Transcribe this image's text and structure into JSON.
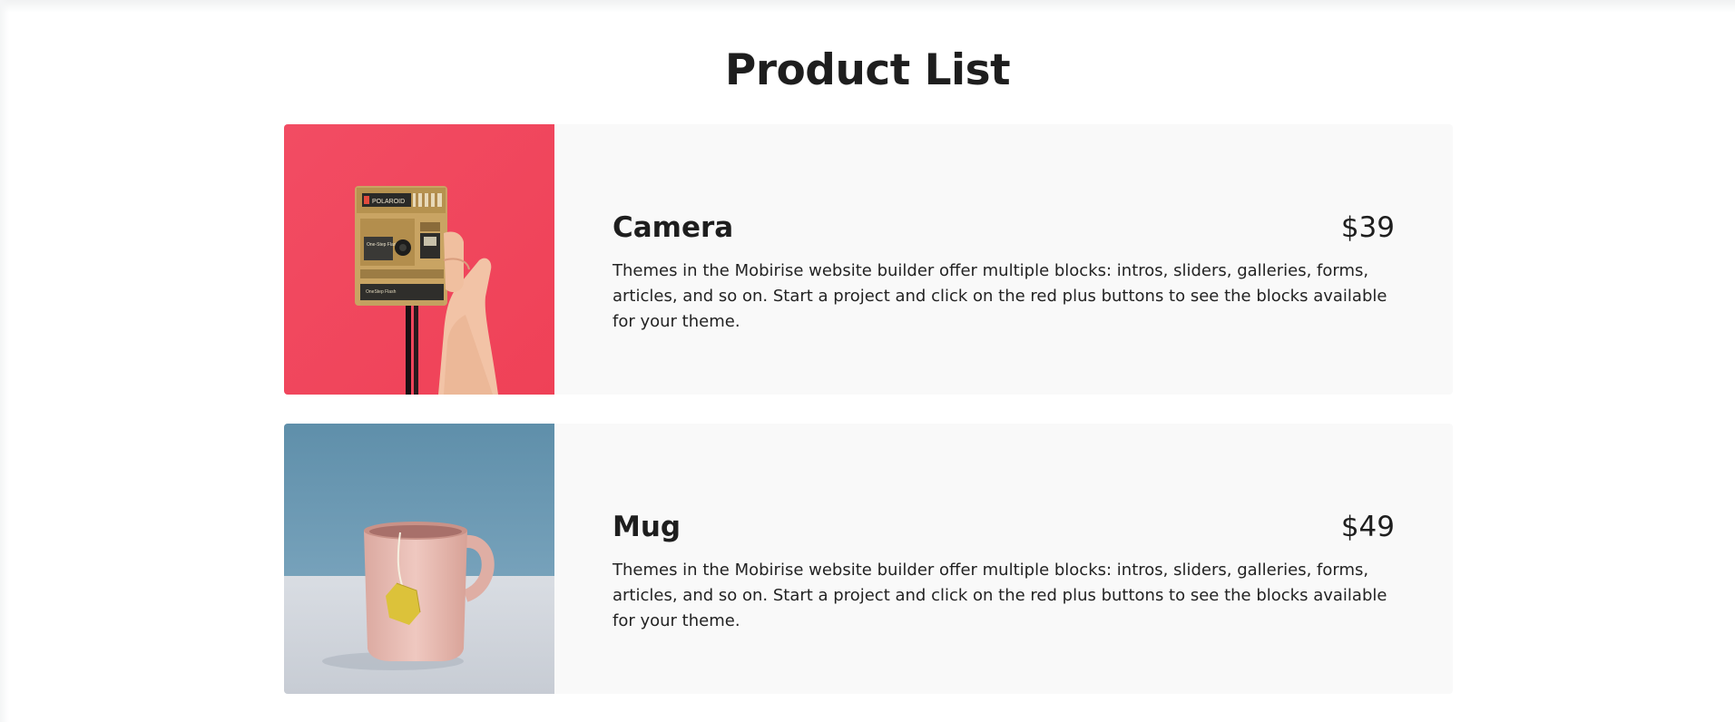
{
  "page": {
    "title": "Product List"
  },
  "products": [
    {
      "name": "Camera",
      "price": "$39",
      "description": "Themes in the Mobirise website builder offer multiple blocks: intros, sliders, galleries, forms, articles, and so on. Start a project and click on the red plus buttons to see the blocks available for your theme.",
      "image": "polaroid-camera-photo",
      "image_background": "#f4475f",
      "camera_brand_text": "POLAROID",
      "camera_label_1": "One-Step Flash",
      "camera_label_2": "OneStep Flash"
    },
    {
      "name": "Mug",
      "price": "$49",
      "description": "Themes in the Mobirise website builder offer multiple blocks: intros, sliders, galleries, forms, articles, and so on. Start a project and click on the red plus buttons to see the blocks available for your theme.",
      "image": "pink-mug-with-tea-tag-photo",
      "image_background": "#6796b0"
    }
  ],
  "colors": {
    "card_background": "#f9f9f9",
    "text": "#232323"
  }
}
